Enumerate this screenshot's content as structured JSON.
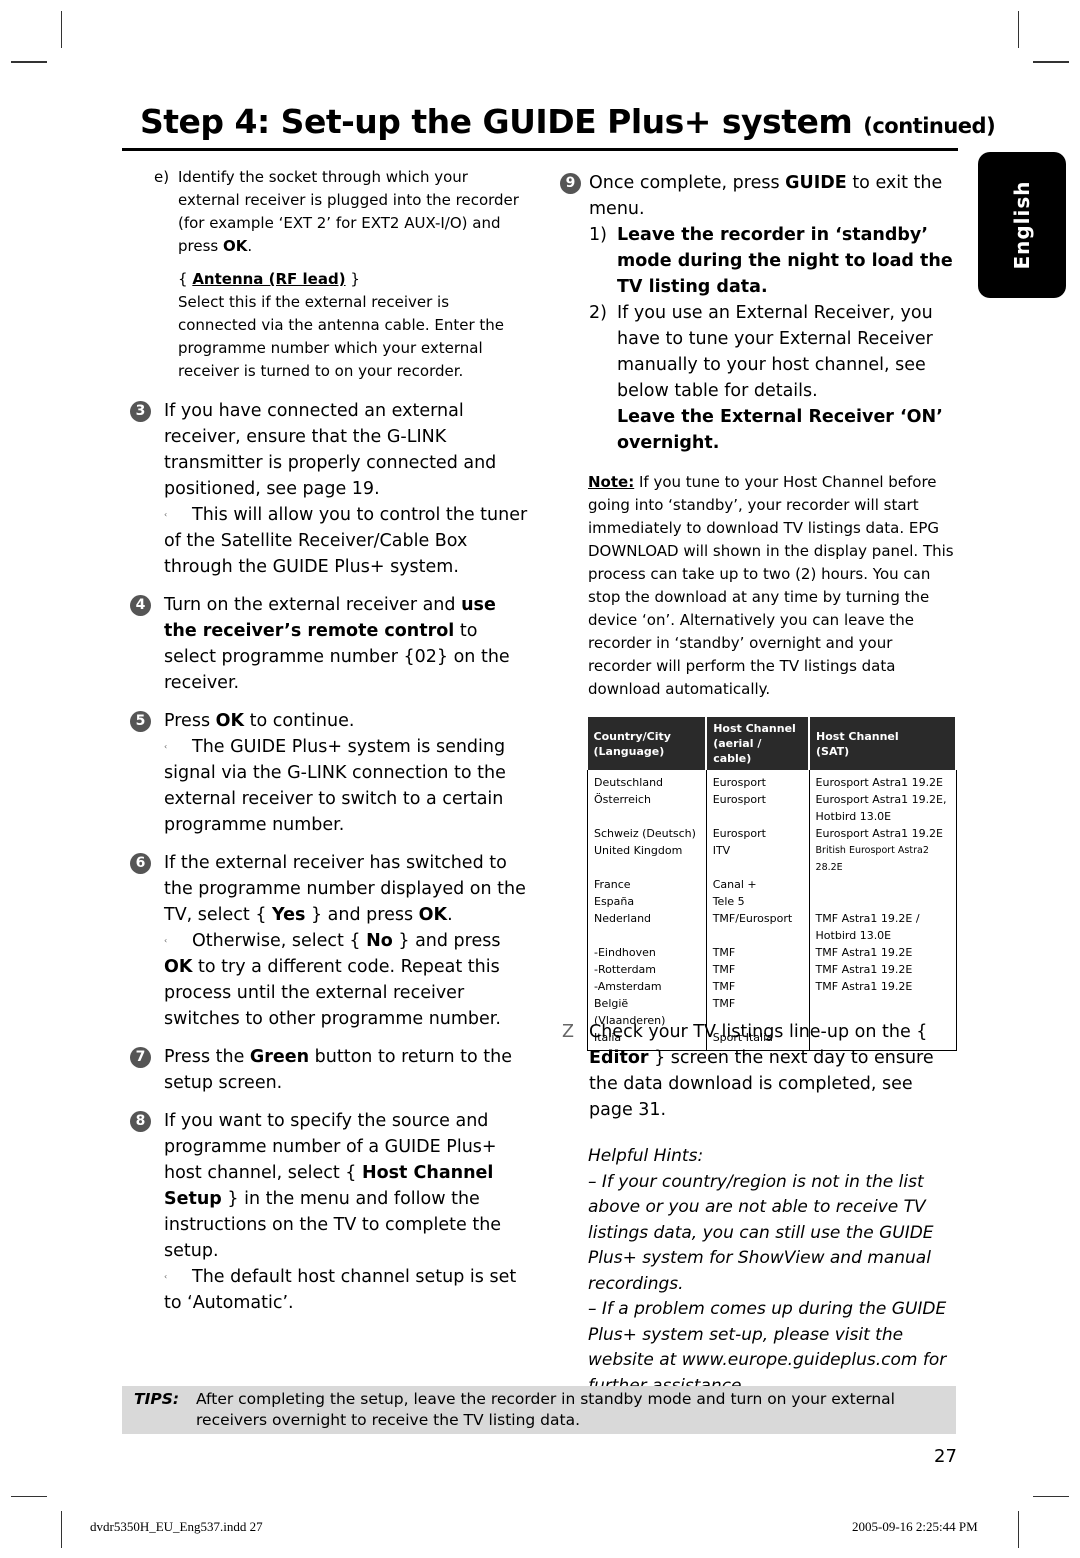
{
  "header": {
    "title": "Step 4: Set-up the GUIDE Plus+ system",
    "title_suffix": "(continued)",
    "language_tab": "English"
  },
  "left": {
    "sub_e": {
      "label": "e)",
      "text_a": "Identify the socket through which your external receiver is plugged into the recorder (for example ‘EXT 2’ for EXT2 AUX-I/O) and press ",
      "text_b": "OK",
      "text_c": ".",
      "option_title": "Antenna (RF lead)",
      "option_desc": "Select this if the external receiver is connected via the antenna cable. Enter the programme number which your external receiver is turned to on your recorder."
    },
    "steps": [
      {
        "num": "3",
        "text": "If you have connected an external receiver, ensure that the G-LINK transmitter is properly connected and positioned, see page 19.",
        "note": "This will allow you to control the tuner of the Satellite Receiver/Cable Box through the GUIDE Plus+ system."
      },
      {
        "num": "4",
        "t1": "Turn on the external receiver and ",
        "b1": "use the receiver’s remote control",
        "t2": " to select programme number {02} on the receiver."
      },
      {
        "num": "5",
        "t1": "Press ",
        "b1": "OK",
        "t2": " to continue.",
        "note": "The GUIDE Plus+ system is sending signal via the G-LINK connection to the external receiver to switch to a certain programme number."
      },
      {
        "num": "6",
        "t1": "If the external receiver has switched to the programme number displayed on the TV, select { ",
        "b1": "Yes",
        "t2": " } and press ",
        "b2": "OK",
        "t3": ".",
        "n1": "Otherwise, select { ",
        "nb1": "No",
        "n2": " } and press ",
        "nb2": "OK",
        "n3": " to try a different code. Repeat this process until the external receiver switches to other programme number."
      },
      {
        "num": "7",
        "t1": "Press the ",
        "b1": "Green",
        "t2": " button to return to the setup screen."
      },
      {
        "num": "8",
        "t1": "If you want to specify the source and programme number of a GUIDE Plus+ host channel, select { ",
        "b1": "Host Channel Setup",
        "t2": " } in the menu and follow the instructions on the TV to complete the setup.",
        "note": "The default host channel setup is set to ‘Automatic’."
      }
    ],
    "arrow_glyph": "‹"
  },
  "right": {
    "step9": {
      "num": "9",
      "t1": "Once complete, press ",
      "b1": "GUIDE",
      "t2": " to exit the menu."
    },
    "sub1": {
      "label": "1)",
      "text": "Leave the recorder in ‘standby’ mode during the night to load the TV listing data."
    },
    "sub2": {
      "label": "2)",
      "text": "If you use an External Receiver, you have to tune your External Receiver manually to your host channel, see below table for details.",
      "bold": "Leave the External Receiver ‘ON’ overnight."
    },
    "note": {
      "label": "Note:",
      "text": " If you tune to your Host Channel before going into ‘standby’, your recorder will start immediately to download TV listings data. EPG DOWNLOAD will shown in the display panel. This process can take up to two (2) hours. You can stop the download at any time by turning the device ‘on’. Alternatively you can leave the recorder in ‘standby’ overnight and your recorder will perform the TV listings data download automatically."
    },
    "table": {
      "headers": [
        [
          "Country/City",
          "(Language)"
        ],
        [
          "Host Channel",
          "(aerial / cable)"
        ],
        [
          "Host Channel",
          "(SAT)"
        ]
      ],
      "rows": [
        [
          "Deutschland",
          "Eurosport",
          "Eurosport Astra1 19.2E"
        ],
        [
          "Österreich",
          "Eurosport",
          "Eurosport Astra1 19.2E,"
        ],
        [
          "",
          "",
          "Hotbird 13.0E"
        ],
        [
          "Schweiz (Deutsch)",
          "Eurosport",
          "Eurosport Astra1 19.2E"
        ],
        [
          "United Kingdom",
          "ITV",
          "British Eurosport Astra2 28.2E"
        ],
        [
          "France",
          "Canal +",
          ""
        ],
        [
          "España",
          "Tele 5",
          ""
        ],
        [
          "Nederland",
          "TMF/Eurosport",
          "TMF Astra1 19.2E /"
        ],
        [
          "",
          "",
          "Hotbird 13.0E"
        ],
        [
          "-Eindhoven",
          "TMF",
          "TMF Astra1 19.2E"
        ],
        [
          "-Rotterdam",
          "TMF",
          "TMF Astra1 19.2E"
        ],
        [
          "-Amsterdam",
          "TMF",
          "TMF Astra1 19.2E"
        ],
        [
          "België (Vlaanderen)",
          "TMF",
          ""
        ],
        [
          "Italia",
          "Sport Italia",
          ""
        ]
      ]
    },
    "step10": {
      "num": "Z",
      "t1": "Check your TV listings line-up on the { ",
      "b1": "Editor",
      "t2": " } screen the next day to ensure the data download is completed, see page 31."
    },
    "hints": {
      "title": "Helpful Hints:",
      "items": [
        "– If your country/region is not in the list above or you are not able to receive TV listings data, you can still use the GUIDE Plus+ system for ShowView and manual recordings.",
        "– If a problem comes up during the GUIDE Plus+ system set-up, please visit the website at www.europe.guideplus.com for further assistance."
      ]
    }
  },
  "tips": {
    "label": "TIPS:",
    "text": "After completing the setup, leave the recorder in standby mode and turn on your external receivers overnight to receive the TV listing data."
  },
  "page_number": "27",
  "footer": {
    "file": "dvdr5350H_EU_Eng537.indd   27",
    "timestamp": "2005-09-16   2:25:44 PM"
  }
}
